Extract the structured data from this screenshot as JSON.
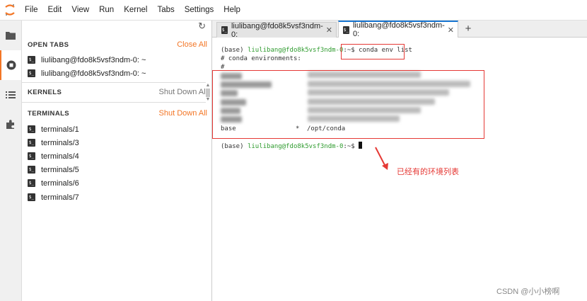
{
  "menu": [
    "File",
    "Edit",
    "View",
    "Run",
    "Kernel",
    "Tabs",
    "Settings",
    "Help"
  ],
  "sidebar": {
    "open_tabs": {
      "title": "OPEN TABS",
      "action": "Close All",
      "items": [
        "liulibang@fdo8k5vsf3ndm-0: ~",
        "liulibang@fdo8k5vsf3ndm-0: ~"
      ]
    },
    "kernels": {
      "title": "KERNELS",
      "action": "Shut Down All"
    },
    "terminals": {
      "title": "TERMINALS",
      "action": "Shut Down All",
      "items": [
        "terminals/1",
        "terminals/3",
        "terminals/4",
        "terminals/5",
        "terminals/6",
        "terminals/7"
      ]
    }
  },
  "tabs": [
    "liulibang@fdo8k5vsf3ndm-0:",
    "liulibang@fdo8k5vsf3ndm-0:"
  ],
  "terminal": {
    "prompt_prefix": "(base) ",
    "prompt_user": "liulibang@fdo8k5vsf3ndm-0",
    "prompt_suffix": ":~$ ",
    "command": "conda env list",
    "header": "# conda environments:",
    "hash": "#",
    "base_name": "base",
    "base_marker": "*",
    "base_path": "/opt/conda"
  },
  "annotation": "已经有的环境列表",
  "watermark": "CSDN @小小榜啊",
  "colors": {
    "accent_orange": "#f37626",
    "tab_blue": "#1976d2",
    "annotation_red": "#e53935",
    "prompt_green": "#2e9b2e"
  }
}
